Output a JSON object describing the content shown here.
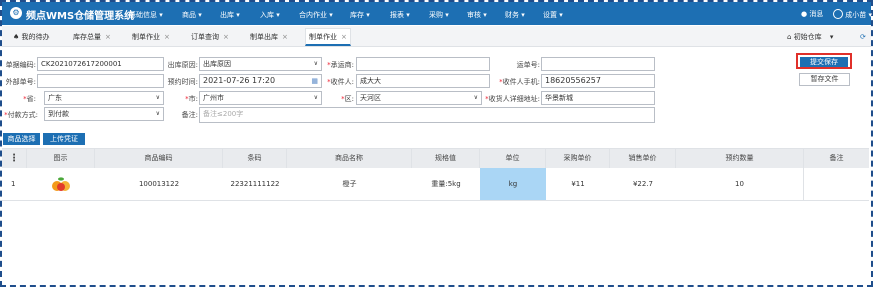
{
  "app": {
    "title": "频点WMS仓储管理系统"
  },
  "menu": [
    "基础信息 ▾",
    "商品 ▾",
    "出库 ▾",
    "入库 ▾",
    "合内作业 ▾",
    "库存 ▾",
    "报表 ▾",
    "采购 ▾",
    "审核 ▾",
    "财务 ▾",
    "设置 ▾"
  ],
  "topbar": {
    "messages_label": "消息",
    "user_label": "成小苗 ▾"
  },
  "tabs": [
    {
      "label": "我的待办"
    },
    {
      "label": "库存总量"
    },
    {
      "label": "制单作业"
    },
    {
      "label": "订单查询"
    },
    {
      "label": "制单出库"
    },
    {
      "label": "制单作业"
    }
  ],
  "tab_close_glyph": "×",
  "warehouse": {
    "label": "初始仓库",
    "caret": "▾",
    "refresh_glyph": "⟳"
  },
  "form": {
    "doc_no_label": "单据编码:",
    "doc_no_value": "CK2021072617200001",
    "out_reason_label": "出库原因:",
    "out_reason_value": "出库原因",
    "carrier_label": "承运商:",
    "carrier_value": "",
    "waybill_label": "运单号:",
    "waybill_value": "",
    "external_no_label": "外部单号:",
    "external_no_value": "",
    "appt_time_label": "预约时间:",
    "appt_time_value": "2021-07-26 17:20",
    "recipient_label": "收件人:",
    "recipient_value": "成大大",
    "recipient_phone_label": "收件人手机:",
    "recipient_phone_value": "18620556257",
    "province_label": "省:",
    "province_value": "广东",
    "city_label": "市:",
    "city_value": "广州市",
    "district_label": "区:",
    "district_value": "天河区",
    "address_label": "收货人详细地址:",
    "address_value": "华景新城",
    "payment_label": "付款方式:",
    "payment_value": "到付款",
    "remark_label": "备注:",
    "remark_placeholder": "备注≤200字",
    "required_mark": "*"
  },
  "actions": {
    "submit_label": "提交保存",
    "draft_label": "暂存文件"
  },
  "toolbar": {
    "select_goods_label": "商品选择",
    "upload_label": "上传凭证"
  },
  "table": {
    "columns": [
      "图示",
      "商品编码",
      "条码",
      "商品名称",
      "规格值",
      "单位",
      "采购单价",
      "销售单价",
      "预约数量",
      "备注"
    ],
    "rows": [
      {
        "index": "1",
        "code": "100013122",
        "barcode": "22321111122",
        "name": "橙子",
        "spec": "重量:5kg",
        "unit": "kg",
        "purchase_price": "¥11",
        "sale_price": "¥22.7",
        "qty": "10",
        "remark": ""
      }
    ]
  },
  "colors": {
    "brand": "#1d6fb3",
    "highlight_border": "#e0302a",
    "unit_cell": "#aad6f5"
  }
}
